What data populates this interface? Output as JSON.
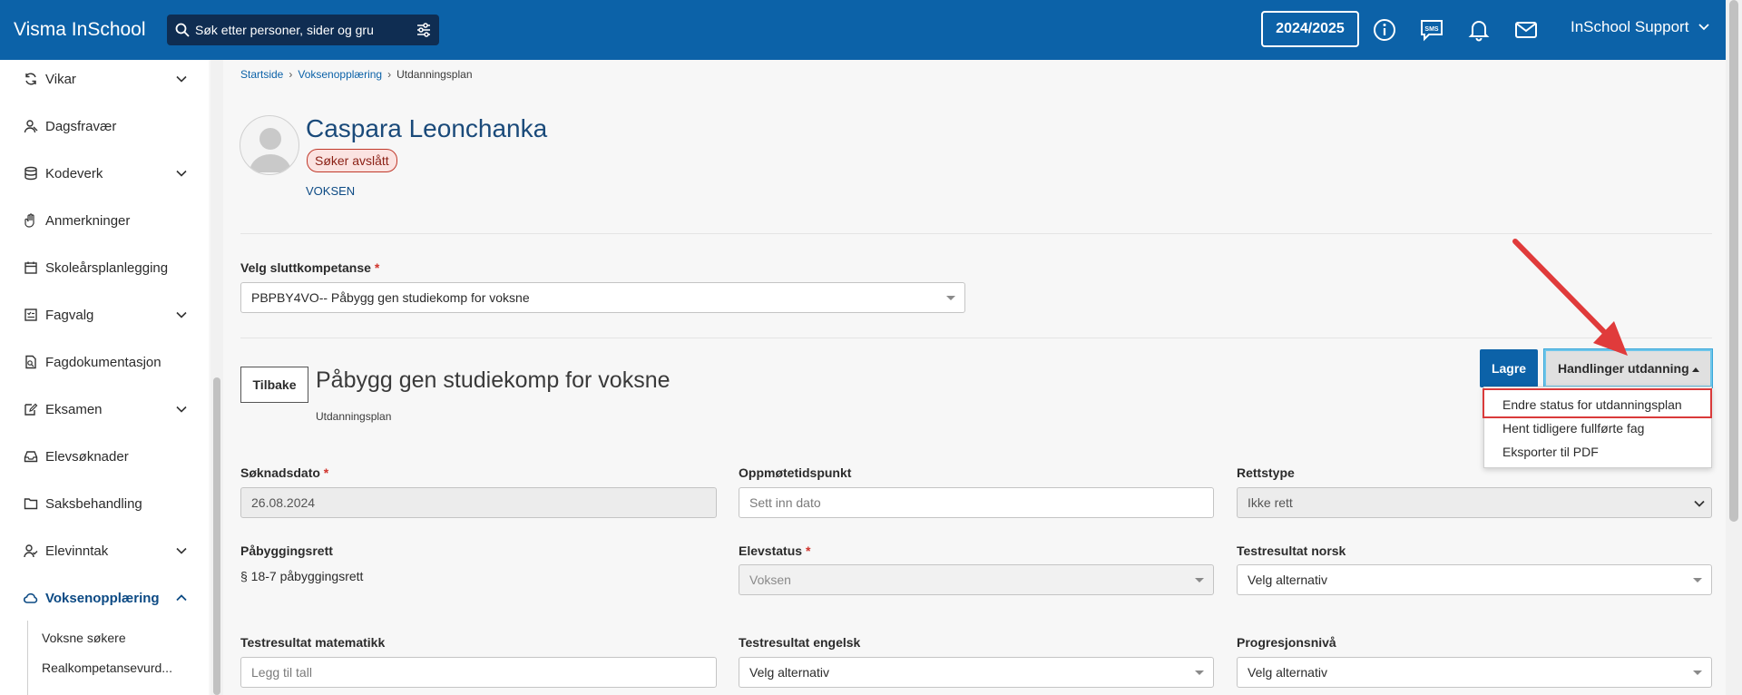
{
  "header": {
    "brand": "Visma InSchool",
    "search_placeholder": "Søk etter personer, sider og gru",
    "school_year": "2024/2025",
    "user": "InSchool Support",
    "bg_color": "#0c62a8"
  },
  "sidebar": {
    "items": [
      {
        "label": "Vikar",
        "icon": "refresh-icon",
        "expandable": true
      },
      {
        "label": "Dagsfravær",
        "icon": "person-icon",
        "expandable": false
      },
      {
        "label": "Kodeverk",
        "icon": "database-icon",
        "expandable": true
      },
      {
        "label": "Anmerkninger",
        "icon": "hand-icon",
        "expandable": false
      },
      {
        "label": "Skoleårsplanlegging",
        "icon": "calendar-icon",
        "expandable": false
      },
      {
        "label": "Fagvalg",
        "icon": "checklist-icon",
        "expandable": true
      },
      {
        "label": "Fagdokumentasjon",
        "icon": "document-icon",
        "expandable": false
      },
      {
        "label": "Eksamen",
        "icon": "edit-icon",
        "expandable": true
      },
      {
        "label": "Elevsøknader",
        "icon": "inbox-icon",
        "expandable": false
      },
      {
        "label": "Saksbehandling",
        "icon": "folder-icon",
        "expandable": false
      },
      {
        "label": "Elevinntak",
        "icon": "person-check-icon",
        "expandable": true
      },
      {
        "label": "Voksenopplæring",
        "icon": "cloud-icon",
        "expandable": true,
        "active": true
      }
    ],
    "sub_items": [
      "Voksne søkere",
      "Realkompetansevurd..."
    ]
  },
  "breadcrumb": [
    "Startside",
    "Voksenopplæring",
    "Utdanningsplan"
  ],
  "person": {
    "name": "Caspara Leonchanka",
    "status_badge": "Søker avslått",
    "category": "VOKSEN"
  },
  "competence": {
    "label": "Velg sluttkompetanse",
    "value": "PBPBY4VO-- Påbygg gen studiekomp for voksne"
  },
  "section": {
    "back_label": "Tilbake",
    "title": "Påbygg gen studiekomp for voksne",
    "subtitle": "Utdanningsplan",
    "save_label": "Lagre",
    "actions_label": "Handlinger utdanning",
    "actions_menu": [
      "Endre status for utdanningsplan",
      "Hent tidligere fullførte fag",
      "Eksporter til PDF"
    ]
  },
  "form": {
    "soknadsdato": {
      "label": "Søknadsdato",
      "value": "26.08.2024"
    },
    "oppmote": {
      "label": "Oppmøtetidspunkt",
      "placeholder": "Sett inn dato"
    },
    "rettstype": {
      "label": "Rettstype",
      "value": "Ikke rett"
    },
    "pabyggingsrett": {
      "label": "Påbyggingsrett",
      "value": "§ 18-7 påbyggingsrett"
    },
    "elevstatus": {
      "label": "Elevstatus",
      "value": "Voksen"
    },
    "test_norsk": {
      "label": "Testresultat norsk",
      "placeholder": "Velg alternativ"
    },
    "test_mat": {
      "label": "Testresultat matematikk",
      "placeholder": "Legg til tall"
    },
    "test_engelsk": {
      "label": "Testresultat engelsk",
      "placeholder": "Velg alternativ"
    },
    "progresjon": {
      "label": "Progresjonsnivå",
      "placeholder": "Velg alternativ"
    }
  },
  "annotation": {
    "arrow_color": "#e03b3b"
  }
}
